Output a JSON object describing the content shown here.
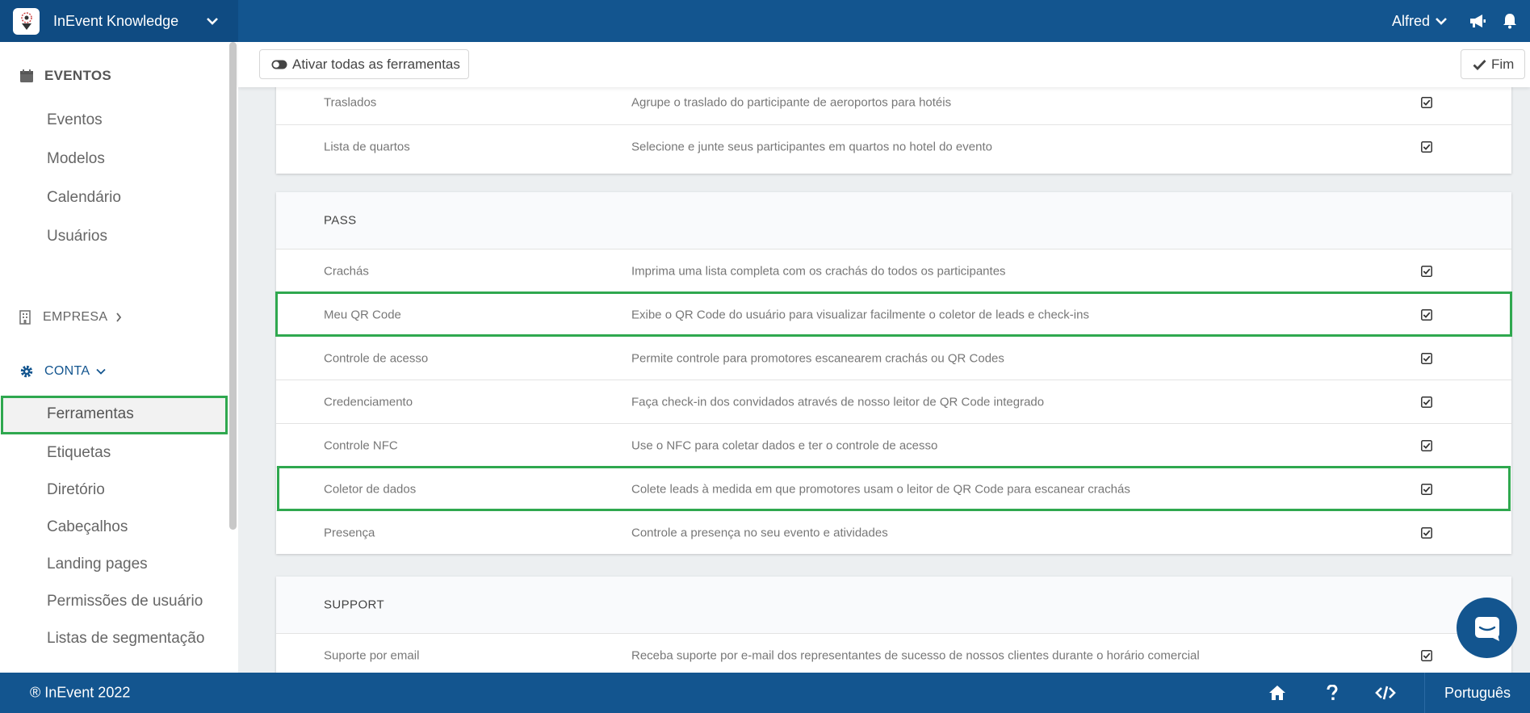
{
  "app": {
    "title": "InEvent Knowledge",
    "user": "Alfred"
  },
  "sidebar": {
    "eventos": {
      "label": "EVENTOS",
      "items": [
        "Eventos",
        "Modelos",
        "Calendário",
        "Usuários"
      ]
    },
    "empresa": {
      "label": "EMPRESA"
    },
    "conta": {
      "label": "CONTA",
      "items": [
        "Ferramentas",
        "Etiquetas",
        "Diretório",
        "Cabeçalhos",
        "Landing pages",
        "Permissões de usuário",
        "Listas de segmentação"
      ]
    }
  },
  "toolbar": {
    "activate_all": "Ativar todas as ferramentas",
    "done": "Fim"
  },
  "tools": {
    "top_rows": [
      {
        "name": "Traslados",
        "desc": "Agrupe o traslado do participante de aeroportos para hotéis",
        "enabled": true
      },
      {
        "name": "Lista de quartos",
        "desc": "Selecione e junte seus participantes em quartos no hotel do evento",
        "enabled": true
      }
    ],
    "pass": {
      "title": "PASS",
      "rows": [
        {
          "name": "Crachás",
          "desc": "Imprima uma lista completa com os crachás do todos os participantes",
          "enabled": true
        },
        {
          "name": "Meu QR Code",
          "desc": "Exibe o QR Code do usuário para visualizar facilmente o coletor de leads e check-ins",
          "enabled": true
        },
        {
          "name": "Controle de acesso",
          "desc": "Permite controle para promotores escanearem crachás ou QR Codes",
          "enabled": true
        },
        {
          "name": "Credenciamento",
          "desc": "Faça check-in dos convidados através de nosso leitor de QR Code integrado",
          "enabled": true
        },
        {
          "name": "Controle NFC",
          "desc": "Use o NFC para coletar dados e ter o controle de acesso",
          "enabled": true
        },
        {
          "name": "Coletor de dados",
          "desc": "Colete leads à medida em que promotores usam o leitor de QR Code para escanear crachás",
          "enabled": true
        },
        {
          "name": "Presença",
          "desc": "Controle a presença no seu evento e atividades",
          "enabled": true
        }
      ]
    },
    "support": {
      "title": "SUPPORT",
      "rows": [
        {
          "name": "Suporte por email",
          "desc": "Receba suporte por e-mail dos representantes de sucesso de nossos clientes durante o horário comercial",
          "enabled": true
        }
      ]
    }
  },
  "footer": {
    "copyright": "® InEvent 2022",
    "language": "Português"
  },
  "colors": {
    "brand_blue": "#13558f",
    "highlight_green": "#2fa84f"
  },
  "icons": [
    "calendar-icon",
    "building-icon",
    "gear-icon",
    "toggle-icon",
    "check-icon",
    "megaphone-icon",
    "bell-icon",
    "home-icon",
    "help-icon",
    "code-icon",
    "chat-icon"
  ]
}
